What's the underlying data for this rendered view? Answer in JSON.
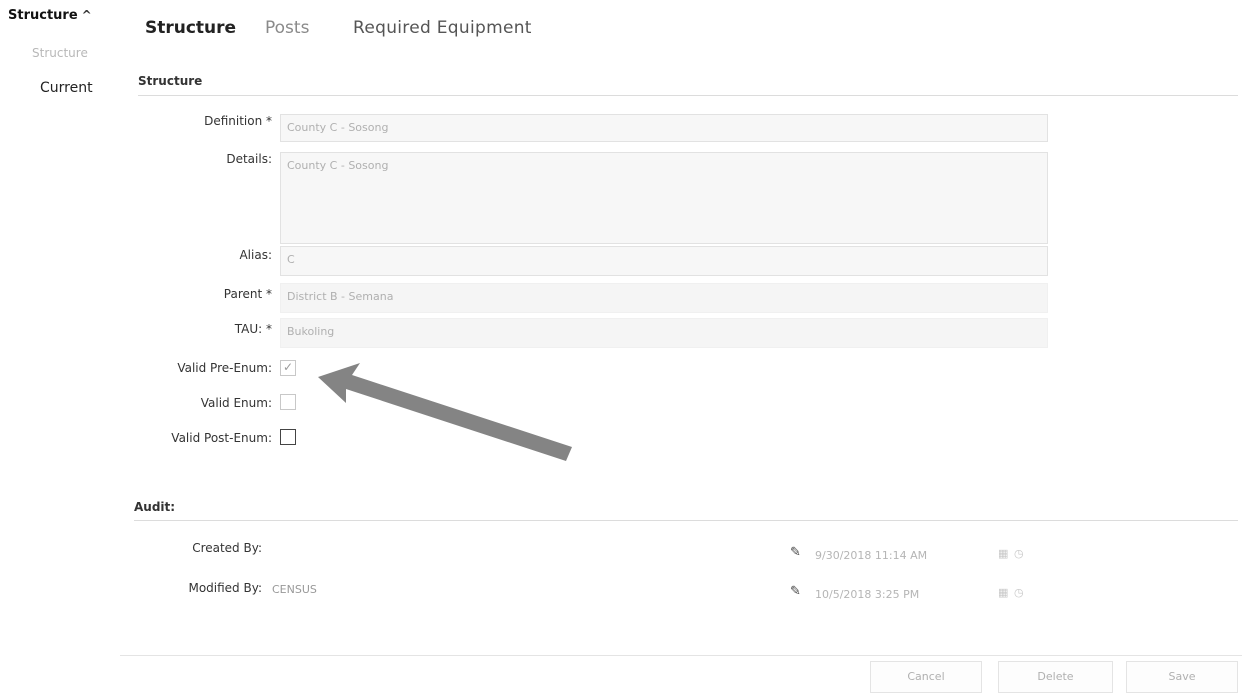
{
  "sidebar": {
    "title": "Structure",
    "sub_item": "Structure",
    "current": "Current"
  },
  "tabs": [
    {
      "label": "Structure",
      "active": true
    },
    {
      "label": "Posts",
      "active": false
    },
    {
      "label": "Required Equipment",
      "active": false
    }
  ],
  "structure_section": {
    "title": "Structure",
    "fields": {
      "definition": {
        "label": "Definition *",
        "value": "County C - Sosong"
      },
      "details": {
        "label": "Details:",
        "value": "County C - Sosong"
      },
      "alias": {
        "label": "Alias:",
        "value": "C"
      },
      "parent": {
        "label": "Parent *",
        "value": "District B - Semana"
      },
      "tau": {
        "label": "TAU: *",
        "value": "Bukoling"
      }
    },
    "checkboxes": {
      "valid_pre_enum": {
        "label": "Valid Pre-Enum:",
        "checked": true
      },
      "valid_enum": {
        "label": "Valid Enum:",
        "checked": false
      },
      "valid_post_enum": {
        "label": "Valid Post-Enum:",
        "checked": false
      }
    }
  },
  "audit": {
    "title": "Audit:",
    "created_by": {
      "label": "Created By:",
      "value": "",
      "date": "9/30/2018 11:14 AM"
    },
    "modified_by": {
      "label": "Modified By:",
      "value": "CENSUS",
      "date": "10/5/2018 3:25 PM"
    }
  },
  "buttons": {
    "cancel": "Cancel",
    "delete": "Delete",
    "save": "Save"
  },
  "icons": {
    "pencil": "✎",
    "calendar": "▦",
    "clock": "◷",
    "checkmark": "✓",
    "chevron_up": "^"
  },
  "colors": {
    "arrow": "#6f6f6f",
    "field_bg": "#f7f7f7"
  }
}
